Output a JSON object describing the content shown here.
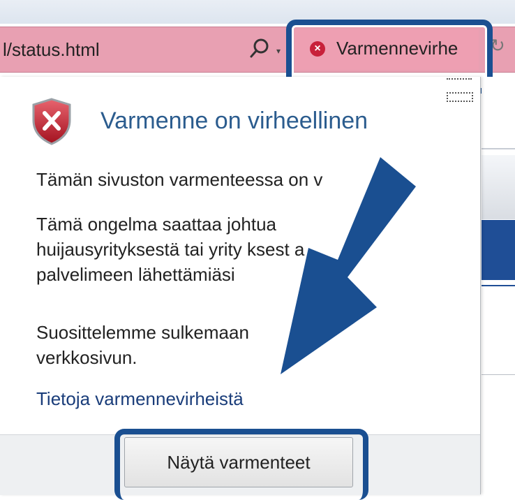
{
  "address_bar": {
    "url_text": "l/status.html",
    "cert_error_label": "Varmennevirhe"
  },
  "popup": {
    "title": "Varmenne on virheellinen",
    "message_1": "Tämän sivuston varmenteessa on v",
    "message_2_lines": [
      "Tämä ongelma saattaa johtua",
      "huijausyrityksestä tai yrity  ksest          a",
      "palvelimeen lähettämiäsi"
    ],
    "message_3_lines": [
      "Suosittelemme sulkemaan",
      "verkkosivun."
    ],
    "learn_more_link": "Tietoja varmennevirheistä",
    "view_certificates_button": "Näytä varmenteet"
  },
  "colors": {
    "address_bar_error": "#e8a0b2",
    "highlight": "#1a4f91",
    "title_text": "#2b5c8e",
    "error_red": "#c8203a"
  },
  "icons": [
    "search-icon",
    "dropdown-arrow-icon",
    "certificate-error-icon",
    "refresh-icon",
    "shield-error-icon",
    "arrow-annotation"
  ]
}
